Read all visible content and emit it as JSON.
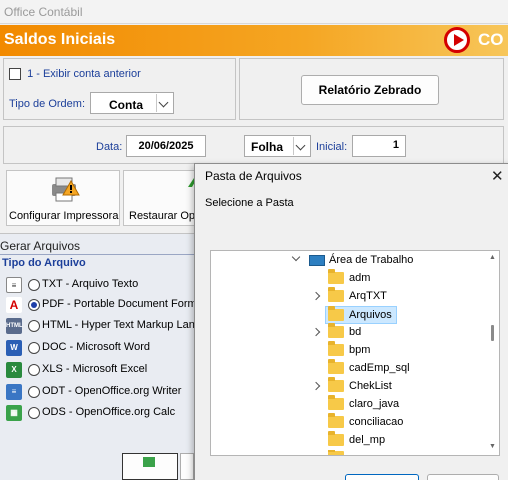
{
  "window": {
    "title": "Office Contábil"
  },
  "header": {
    "title": "Saldos Iniciais",
    "brand": "CO",
    "accent": "#f28a00"
  },
  "options": {
    "show_prev_account": "1 - Exibir conta anterior",
    "order_label": "Tipo de Ordem:",
    "order_value": "Conta",
    "report_button": "Relatório Zebrado"
  },
  "date_bar": {
    "date_label": "Data:",
    "date_value": "20/06/2025",
    "sheet_value": "Folha",
    "initial_label": "Inicial:",
    "initial_value": "1"
  },
  "toolbar": {
    "printer_button": "Configurar Impressora",
    "restore_button": "Restaurar Op"
  },
  "files": {
    "section_title": "Gerar Arquivos",
    "type_title": "Tipo do Arquivo",
    "types": [
      {
        "label": "TXT - Arquivo Texto",
        "icon": "txt-file-icon",
        "selected": false
      },
      {
        "label": "PDF - Portable Document Forma",
        "icon": "pdf-file-icon",
        "selected": true
      },
      {
        "label": "HTML - Hyper Text Markup Lang",
        "icon": "html-file-icon",
        "selected": false
      },
      {
        "label": "DOC - Microsoft Word",
        "icon": "word-file-icon",
        "selected": false
      },
      {
        "label": "XLS - Microsoft Excel",
        "icon": "excel-file-icon",
        "selected": false
      },
      {
        "label": "ODT - OpenOffice.org Writer",
        "icon": "odt-file-icon",
        "selected": false
      },
      {
        "label": "ODS - OpenOffice.org Calc",
        "icon": "ods-file-icon",
        "selected": false
      }
    ]
  },
  "dialog": {
    "title": "Pasta de Arquivos",
    "prompt": "Selecione a Pasta",
    "tree_root": "Área de Trabalho",
    "folders": [
      {
        "name": "adm",
        "expandable": false,
        "selected": false
      },
      {
        "name": "ArqTXT",
        "expandable": true,
        "selected": false
      },
      {
        "name": "Arquivos",
        "expandable": false,
        "selected": true
      },
      {
        "name": "bd",
        "expandable": true,
        "selected": false
      },
      {
        "name": "bpm",
        "expandable": false,
        "selected": false
      },
      {
        "name": "cadEmp_sql",
        "expandable": false,
        "selected": false
      },
      {
        "name": "ChekList",
        "expandable": true,
        "selected": false
      },
      {
        "name": "claro_java",
        "expandable": false,
        "selected": false
      },
      {
        "name": "conciliacao",
        "expandable": false,
        "selected": false
      },
      {
        "name": "del_mp",
        "expandable": false,
        "selected": false
      }
    ]
  }
}
